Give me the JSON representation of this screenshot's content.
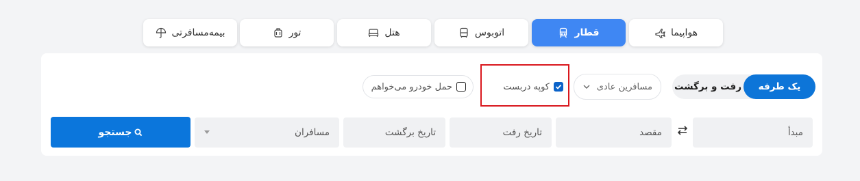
{
  "tabs": [
    {
      "label": "هواپیما",
      "icon": "airplane-icon",
      "active": false
    },
    {
      "label": "قطار",
      "icon": "train-icon",
      "active": true
    },
    {
      "label": "اتوبوس",
      "icon": "bus-icon",
      "active": false
    },
    {
      "label": "هتل",
      "icon": "bed-icon",
      "active": false
    },
    {
      "label": "تور",
      "icon": "suitcase-icon",
      "active": false
    },
    {
      "label": "بیمه‌مسافرتی",
      "icon": "umbrella-icon",
      "active": false
    }
  ],
  "trip_type": {
    "one_way": "یک طرفه",
    "round_trip": "رفت و برگشت",
    "selected": "one_way"
  },
  "passenger_type": {
    "value": "مسافرین عادی"
  },
  "options": {
    "coupe": {
      "label": "کوپه دربست",
      "checked": true
    },
    "car": {
      "label": "حمل خودرو می‌خواهم",
      "checked": false
    }
  },
  "fields": {
    "origin": "مبدأ",
    "destination": "مقصد",
    "depart_date": "تاریخ رفت",
    "return_date": "تاریخ برگشت",
    "passengers": "مسافران"
  },
  "search": {
    "label": "جستجو"
  },
  "colors": {
    "accent": "#3f87f3",
    "primary": "#0b76dc",
    "highlight": "#d9171d"
  }
}
